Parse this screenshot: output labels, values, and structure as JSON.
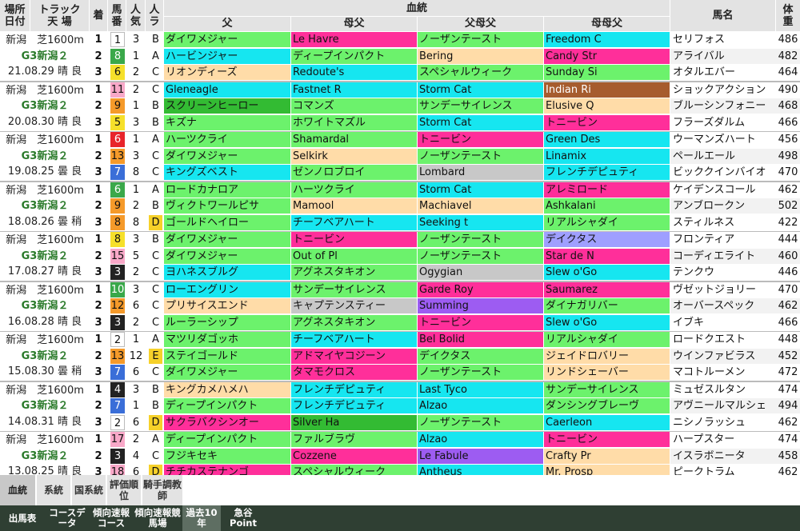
{
  "header": {
    "place_date": [
      "場所",
      "日付"
    ],
    "track": [
      "トラック",
      "天 場"
    ],
    "rank": "着",
    "horse_no": [
      "馬",
      "番"
    ],
    "pop": [
      "人",
      "気"
    ],
    "ra": [
      "人",
      "ラ"
    ],
    "pedigree": "血統",
    "sire": "父",
    "dam_sire": "母父",
    "sire_dam_sire": "父母父",
    "dam_dam_sire": "母母父",
    "horse_name": "馬名",
    "weight": [
      "体",
      "重"
    ]
  },
  "colors": {
    "green": "#6cf26c",
    "dkgreen": "#33bb33",
    "magenta": "#ff2f9a",
    "cyan": "#16e6f0",
    "peach": "#ffdca8",
    "purple": "#9d5cf2",
    "gray": "#c8c8c8",
    "brown": "#a65c2e",
    "lavender": "#9f9fff",
    "white": "#ffffff"
  },
  "races": [
    {
      "line1": "新潟　芝1600m",
      "line2": "G3新潟２",
      "line3": "21.08.29 晴 良",
      "rows": [
        {
          "rank": "1",
          "no": "1",
          "no_color": "#ffffff",
          "no_text": "#111",
          "pop": "3",
          "ra": "B",
          "ra_color": "",
          "sire": "ダイワメジャー",
          "sire_c": "green",
          "ds": "Le Havre",
          "ds_c": "magenta",
          "sds": "ノーザンテースト",
          "sds_c": "green",
          "dds": "Freedom C",
          "dds_c": "cyan",
          "name": "セリフォス",
          "wt": "486"
        },
        {
          "rank": "2",
          "no": "8",
          "no_color": "#3aa84a",
          "no_text": "#fff",
          "pop": "1",
          "ra": "A",
          "ra_color": "",
          "sire": "ハービンジャー",
          "sire_c": "cyan",
          "ds": "ディープインパクト",
          "ds_c": "green",
          "sds": "Bering",
          "sds_c": "peach",
          "dds": "Candy Str",
          "dds_c": "magenta",
          "name": "アライバル",
          "wt": "482"
        },
        {
          "rank": "3",
          "no": "6",
          "no_color": "#f6e02a",
          "no_text": "#111",
          "pop": "2",
          "ra": "C",
          "ra_color": "",
          "sire": "リオンディーズ",
          "sire_c": "peach",
          "ds": "Redoute's",
          "ds_c": "cyan",
          "sds": "スペシャルウィーク",
          "sds_c": "green",
          "dds": "Sunday Si",
          "dds_c": "green",
          "name": "オタルエバー",
          "wt": "464"
        }
      ]
    },
    {
      "line1": "新潟　芝1600m",
      "line2": "G3新潟２",
      "line3": "20.08.30 晴 良",
      "rows": [
        {
          "rank": "1",
          "no": "11",
          "no_color": "#f8a8c8",
          "no_text": "#111",
          "pop": "2",
          "ra": "C",
          "ra_color": "",
          "sire": "Gleneagle",
          "sire_c": "cyan",
          "ds": "Fastnet R",
          "ds_c": "cyan",
          "sds": "Storm Cat",
          "sds_c": "cyan",
          "dds": "Indian Ri",
          "dds_c": "brown",
          "name": "ショックアクション",
          "wt": "490"
        },
        {
          "rank": "2",
          "no": "9",
          "no_color": "#f59a2a",
          "no_text": "#111",
          "pop": "1",
          "ra": "B",
          "ra_color": "",
          "sire": "スクリーンヒーロー",
          "sire_c": "dkgreen",
          "ds": "コマンズ",
          "ds_c": "green",
          "sds": "サンデーサイレンス",
          "sds_c": "green",
          "dds": "Elusive Q",
          "dds_c": "peach",
          "name": "ブルーシンフォニー",
          "wt": "468"
        },
        {
          "rank": "3",
          "no": "5",
          "no_color": "#f6e02a",
          "no_text": "#111",
          "pop": "3",
          "ra": "B",
          "ra_color": "",
          "sire": "キズナ",
          "sire_c": "green",
          "ds": "ホワイトマズル",
          "ds_c": "green",
          "sds": "Storm Cat",
          "sds_c": "cyan",
          "dds": "トニービン",
          "dds_c": "magenta",
          "name": "フラーズダルム",
          "wt": "466"
        }
      ]
    },
    {
      "line1": "新潟　芝1600m",
      "line2": "G3新潟２",
      "line3": "19.08.25 曇 良",
      "rows": [
        {
          "rank": "1",
          "no": "6",
          "no_color": "#e8242a",
          "no_text": "#fff",
          "pop": "1",
          "ra": "A",
          "ra_color": "",
          "sire": "ハーツクライ",
          "sire_c": "green",
          "ds": "Shamardal",
          "ds_c": "green",
          "sds": "トニービン",
          "sds_c": "magenta",
          "dds": "Green Des",
          "dds_c": "cyan",
          "name": "ウーマンズハート",
          "wt": "456"
        },
        {
          "rank": "2",
          "no": "13",
          "no_color": "#f59a2a",
          "no_text": "#111",
          "pop": "3",
          "ra": "C",
          "ra_color": "",
          "sire": "ダイワメジャー",
          "sire_c": "green",
          "ds": "Selkirk",
          "ds_c": "peach",
          "sds": "ノーザンテースト",
          "sds_c": "green",
          "dds": "Linamix",
          "dds_c": "cyan",
          "name": "ペールエール",
          "wt": "498"
        },
        {
          "rank": "3",
          "no": "7",
          "no_color": "#3a6ed8",
          "no_text": "#fff",
          "pop": "8",
          "ra": "C",
          "ra_color": "",
          "sire": "キングズベスト",
          "sire_c": "cyan",
          "ds": "ゼンノロブロイ",
          "ds_c": "green",
          "sds": "Lombard",
          "sds_c": "gray",
          "dds": "フレンチデピュティ",
          "dds_c": "cyan",
          "name": "ビッククインバイオ",
          "wt": "470"
        }
      ]
    },
    {
      "line1": "新潟　芝1600m",
      "line2": "G3新潟２",
      "line3": "18.08.26 曇 稍",
      "rows": [
        {
          "rank": "1",
          "no": "6",
          "no_color": "#3aa84a",
          "no_text": "#fff",
          "pop": "1",
          "ra": "A",
          "ra_color": "",
          "sire": "ロードカナロア",
          "sire_c": "green",
          "ds": "ハーツクライ",
          "ds_c": "green",
          "sds": "Storm Cat",
          "sds_c": "cyan",
          "dds": "アレミロード",
          "dds_c": "magenta",
          "name": "ケイデンスコール",
          "wt": "462"
        },
        {
          "rank": "2",
          "no": "9",
          "no_color": "#f59a2a",
          "no_text": "#111",
          "pop": "2",
          "ra": "B",
          "ra_color": "",
          "sire": "ヴィクトワールピサ",
          "sire_c": "green",
          "ds": "Mamool",
          "ds_c": "peach",
          "sds": "Machiavel",
          "sds_c": "peach",
          "dds": "Ashkalani",
          "dds_c": "green",
          "name": "アンブロークン",
          "wt": "502"
        },
        {
          "rank": "3",
          "no": "8",
          "no_color": "#f59a2a",
          "no_text": "#111",
          "pop": "8",
          "ra": "D",
          "ra_color": "#f6d12a",
          "sire": "ゴールドヘイロー",
          "sire_c": "green",
          "ds": "チーフベアハート",
          "ds_c": "cyan",
          "sds": "Seeking t",
          "sds_c": "cyan",
          "dds": "リアルシャダイ",
          "dds_c": "green",
          "name": "スティルネス",
          "wt": "422"
        }
      ]
    },
    {
      "line1": "新潟　芝1600m",
      "line2": "G3新潟２",
      "line3": "17.08.27 晴 良",
      "rows": [
        {
          "rank": "1",
          "no": "8",
          "no_color": "#f6e02a",
          "no_text": "#111",
          "pop": "3",
          "ra": "B",
          "ra_color": "",
          "sire": "ダイワメジャー",
          "sire_c": "green",
          "ds": "トニービン",
          "ds_c": "magenta",
          "sds": "ノーザンテースト",
          "sds_c": "green",
          "dds": "デイクタス",
          "dds_c": "lavender",
          "name": "フロンティア",
          "wt": "444"
        },
        {
          "rank": "2",
          "no": "15",
          "no_color": "#f8a8c8",
          "no_text": "#111",
          "pop": "5",
          "ra": "C",
          "ra_color": "",
          "sire": "ダイワメジャー",
          "sire_c": "green",
          "ds": "Out of Pl",
          "ds_c": "green",
          "sds": "ノーザンテースト",
          "sds_c": "green",
          "dds": "Star de N",
          "dds_c": "magenta",
          "name": "コーディエライト",
          "wt": "460"
        },
        {
          "rank": "3",
          "no": "3",
          "no_color": "#222222",
          "no_text": "#fff",
          "pop": "2",
          "ra": "C",
          "ra_color": "",
          "sire": "ヨハネスブルグ",
          "sire_c": "cyan",
          "ds": "アグネスタキオン",
          "ds_c": "green",
          "sds": "Ogygian",
          "sds_c": "gray",
          "dds": "Slew o'Go",
          "dds_c": "cyan",
          "name": "テンクウ",
          "wt": "446"
        }
      ]
    },
    {
      "line1": "新潟　芝1600m",
      "line2": "G3新潟２",
      "line3": "16.08.28 晴 良",
      "rows": [
        {
          "rank": "1",
          "no": "10",
          "no_color": "#3aa84a",
          "no_text": "#fff",
          "pop": "3",
          "ra": "C",
          "ra_color": "",
          "sire": "ローエングリン",
          "sire_c": "cyan",
          "ds": "サンデーサイレンス",
          "ds_c": "green",
          "sds": "Garde Roy",
          "sds_c": "magenta",
          "dds": "Saumarez",
          "dds_c": "magenta",
          "name": "ヴゼットジョリー",
          "wt": "470"
        },
        {
          "rank": "2",
          "no": "12",
          "no_color": "#f59a2a",
          "no_text": "#111",
          "pop": "6",
          "ra": "C",
          "ra_color": "",
          "sire": "プリサイスエンド",
          "sire_c": "peach",
          "ds": "キャプテンスティー",
          "ds_c": "gray",
          "sds": "Summing",
          "sds_c": "purple",
          "dds": "ダイナガリバー",
          "dds_c": "green",
          "name": "オーバースペック",
          "wt": "462"
        },
        {
          "rank": "3",
          "no": "3",
          "no_color": "#222222",
          "no_text": "#fff",
          "pop": "2",
          "ra": "C",
          "ra_color": "",
          "sire": "ルーラーシップ",
          "sire_c": "green",
          "ds": "アグネスタキオン",
          "ds_c": "green",
          "sds": "トニービン",
          "sds_c": "magenta",
          "dds": "Slew o'Go",
          "dds_c": "cyan",
          "name": "イブキ",
          "wt": "466"
        }
      ]
    },
    {
      "line1": "新潟　芝1600m",
      "line2": "G3新潟２",
      "line3": "15.08.30 曇 稍",
      "rows": [
        {
          "rank": "1",
          "no": "2",
          "no_color": "#ffffff",
          "no_text": "#111",
          "pop": "1",
          "ra": "A",
          "ra_color": "",
          "sire": "マツリダゴッホ",
          "sire_c": "green",
          "ds": "チーフベアハート",
          "ds_c": "cyan",
          "sds": "Bel Bolid",
          "sds_c": "magenta",
          "dds": "リアルシャダイ",
          "dds_c": "green",
          "name": "ロードクエスト",
          "wt": "448"
        },
        {
          "rank": "2",
          "no": "13",
          "no_color": "#f59a2a",
          "no_text": "#111",
          "pop": "12",
          "ra": "E",
          "ra_color": "#f6d12a",
          "sire": "ステイゴールド",
          "sire_c": "green",
          "ds": "アドマイヤコジーン",
          "ds_c": "magenta",
          "sds": "デイクタス",
          "sds_c": "green",
          "dds": "ジェイドロバリー",
          "dds_c": "peach",
          "name": "ウインファビラス",
          "wt": "452"
        },
        {
          "rank": "3",
          "no": "7",
          "no_color": "#3a6ed8",
          "no_text": "#fff",
          "pop": "6",
          "ra": "C",
          "ra_color": "",
          "sire": "ダイワメジャー",
          "sire_c": "green",
          "ds": "タマモクロス",
          "ds_c": "magenta",
          "sds": "ノーザンテースト",
          "sds_c": "green",
          "dds": "リンドシェーバー",
          "dds_c": "peach",
          "name": "マコトルーメン",
          "wt": "472"
        }
      ]
    },
    {
      "line1": "新潟　芝1600m",
      "line2": "G3新潟２",
      "line3": "14.08.31 晴 良",
      "rows": [
        {
          "rank": "1",
          "no": "4",
          "no_color": "#222222",
          "no_text": "#fff",
          "pop": "3",
          "ra": "B",
          "ra_color": "",
          "sire": "キングカメハメハ",
          "sire_c": "peach",
          "ds": "フレンチデピュティ",
          "ds_c": "cyan",
          "sds": "Last Tyco",
          "sds_c": "cyan",
          "dds": "サンデーサイレンス",
          "dds_c": "green",
          "name": "ミュゼスルタン",
          "wt": "474"
        },
        {
          "rank": "2",
          "no": "7",
          "no_color": "#3a6ed8",
          "no_text": "#fff",
          "pop": "1",
          "ra": "B",
          "ra_color": "",
          "sire": "ディープインパクト",
          "sire_c": "green",
          "ds": "フレンチデピュティ",
          "ds_c": "cyan",
          "sds": "Alzao",
          "sds_c": "cyan",
          "dds": "ダンシングブレーヴ",
          "dds_c": "green",
          "name": "アヴニールマルシェ",
          "wt": "494"
        },
        {
          "rank": "3",
          "no": "2",
          "no_color": "#ffffff",
          "no_text": "#111",
          "pop": "6",
          "ra": "D",
          "ra_color": "#f6d12a",
          "sire": "サクラバクシンオー",
          "sire_c": "magenta",
          "ds": "Silver Ha",
          "ds_c": "dkgreen",
          "sds": "ノーザンテースト",
          "sds_c": "green",
          "dds": "Caerleon",
          "dds_c": "cyan",
          "name": "ニシノラッシュ",
          "wt": "462"
        }
      ]
    },
    {
      "line1": "新潟　芝1600m",
      "line2": "G3新潟２",
      "line3": "13.08.25 晴 良",
      "rows": [
        {
          "rank": "1",
          "no": "17",
          "no_color": "#f8a8c8",
          "no_text": "#111",
          "pop": "2",
          "ra": "A",
          "ra_color": "",
          "sire": "ディープインパクト",
          "sire_c": "green",
          "ds": "ファルブラヴ",
          "ds_c": "green",
          "sds": "Alzao",
          "sds_c": "cyan",
          "dds": "トニービン",
          "dds_c": "magenta",
          "name": "ハープスター",
          "wt": "474"
        },
        {
          "rank": "2",
          "no": "3",
          "no_color": "#222222",
          "no_text": "#fff",
          "pop": "4",
          "ra": "C",
          "ra_color": "",
          "sire": "フジキセキ",
          "sire_c": "green",
          "ds": "Cozzene",
          "ds_c": "magenta",
          "sds": "Le Fabule",
          "sds_c": "purple",
          "dds": "Crafty Pr",
          "dds_c": "peach",
          "name": "イスラボニータ",
          "wt": "458"
        },
        {
          "rank": "3",
          "no": "18",
          "no_color": "#f8a8c8",
          "no_text": "#111",
          "pop": "6",
          "ra": "D",
          "ra_color": "#f6d12a",
          "sire": "チチカステナンゴ",
          "sire_c": "magenta",
          "ds": "スペシャルウィーク",
          "ds_c": "green",
          "sds": "Antheus",
          "sds_c": "cyan",
          "dds": "Mr. Prosp",
          "dds_c": "peach",
          "name": "ピークトラム",
          "wt": "462"
        }
      ]
    }
  ],
  "subtabs": [
    {
      "label": "血統",
      "active": true
    },
    {
      "label": "系統",
      "active": false
    },
    {
      "label": "国系統",
      "active": false
    },
    {
      "label": "評価順位",
      "active": false
    },
    {
      "label": "騎手調教師",
      "active": false
    }
  ],
  "bottom_tabs": [
    {
      "label": "出馬表",
      "active": false
    },
    {
      "label": "コースデータ",
      "active": false
    },
    {
      "label": "傾向速報コース",
      "active": false
    },
    {
      "label": "傾向速報競馬場",
      "active": false
    },
    {
      "label": "過去10年",
      "active": true
    },
    {
      "label": "急谷Point",
      "active": false
    }
  ]
}
